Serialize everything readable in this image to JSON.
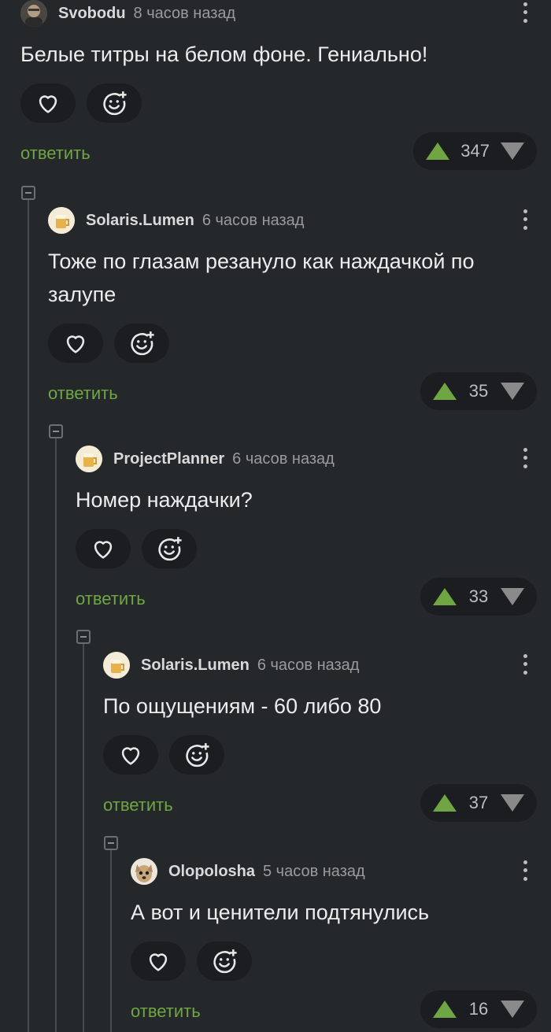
{
  "colors": {
    "background": "#25282b",
    "accent_green": "#6fa643",
    "pill_bg": "#1b1d20",
    "muted": "#9a9a9a"
  },
  "comments": [
    {
      "author": "Svobodu",
      "time": "8 часов назад",
      "text": "Белые титры на белом фоне. Гениально!",
      "reply_label": "ответить",
      "score": "347",
      "avatar": "photo-avatar"
    },
    {
      "author": "Solaris.Lumen",
      "time": "6 часов назад",
      "text": "Тоже по глазам резануло как наждачкой по залупе",
      "reply_label": "ответить",
      "score": "35",
      "avatar": "beer-avatar"
    },
    {
      "author": "ProjectPlanner",
      "time": "6 часов назад",
      "text": "Номер наждачки?",
      "reply_label": "ответить",
      "score": "33",
      "avatar": "beer-avatar"
    },
    {
      "author": "Solaris.Lumen",
      "time": "6 часов назад",
      "text": "По ощущениям - 60 либо 80",
      "reply_label": "ответить",
      "score": "37",
      "avatar": "beer-avatar"
    },
    {
      "author": "Olopolosha",
      "time": "5 часов назад",
      "text": "А вот и ценители подтянулись",
      "reply_label": "ответить",
      "score": "16",
      "avatar": "dog-avatar"
    }
  ],
  "icons": {
    "like": "heart-icon",
    "react": "emoji-add-icon",
    "menu": "more-vertical-icon",
    "upvote": "arrow-up-icon",
    "downvote": "arrow-down-icon",
    "collapse": "collapse-thread-icon"
  }
}
